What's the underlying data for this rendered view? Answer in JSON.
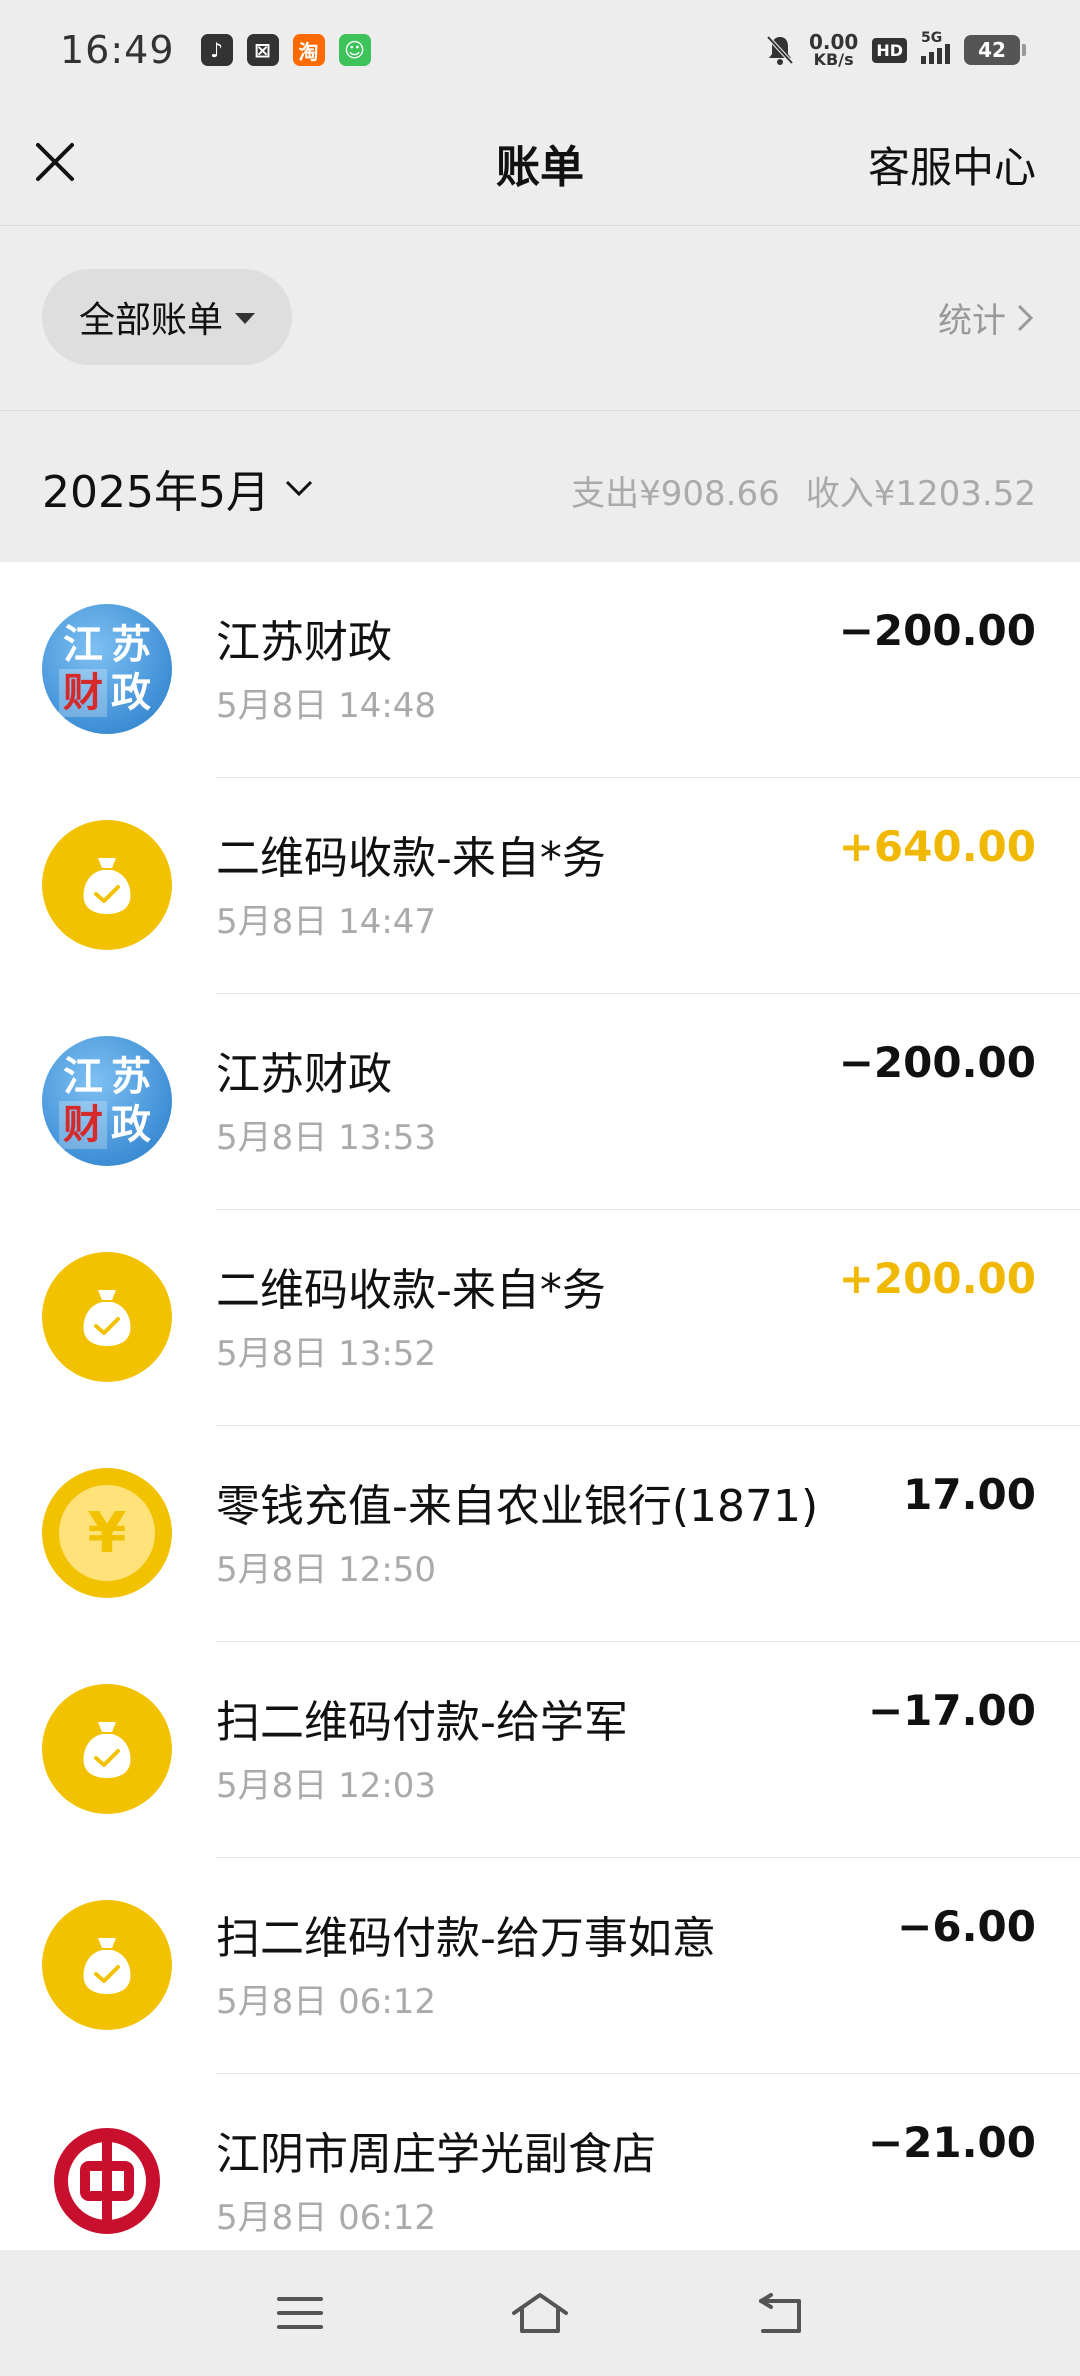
{
  "status_bar": {
    "time": "16:49",
    "net_speed_value": "0.00",
    "net_speed_unit": "KB/s",
    "hd_label": "HD",
    "network_label": "5G",
    "battery_level": "42",
    "app_icons": [
      {
        "name": "douyin-icon",
        "glyph": "♪",
        "color": "#333333"
      },
      {
        "name": "app-icon",
        "glyph": "⊠",
        "color": "#333333"
      },
      {
        "name": "taobao-icon",
        "glyph": "淘",
        "color": "#ff6a00"
      },
      {
        "name": "message-icon",
        "glyph": "☺",
        "color": "#3dc35a"
      }
    ]
  },
  "nav": {
    "title": "账单",
    "service_label": "客服中心"
  },
  "filter": {
    "all_bills_label": "全部账单",
    "stats_label": "统计"
  },
  "month": {
    "label": "2025年5月",
    "expense": "支出¥908.66",
    "income": "收入¥1203.52"
  },
  "bills": [
    {
      "avatar": "finance",
      "title": "江苏财政",
      "time": "5月8日 14:48",
      "amount": "−200.00",
      "type": "expense"
    },
    {
      "avatar": "moneybag",
      "title": "二维码收款-来自*务",
      "time": "5月8日 14:47",
      "amount": "+640.00",
      "type": "income"
    },
    {
      "avatar": "finance",
      "title": "江苏财政",
      "time": "5月8日 13:53",
      "amount": "−200.00",
      "type": "expense"
    },
    {
      "avatar": "moneybag",
      "title": "二维码收款-来自*务",
      "time": "5月8日 13:52",
      "amount": "+200.00",
      "type": "income"
    },
    {
      "avatar": "coin",
      "title": "零钱充值-来自农业银行(1871)",
      "time": "5月8日 12:50",
      "amount": "17.00",
      "type": "neutral"
    },
    {
      "avatar": "moneybag",
      "title": "扫二维码付款-给学军",
      "time": "5月8日 12:03",
      "amount": "−17.00",
      "type": "expense"
    },
    {
      "avatar": "moneybag",
      "title": "扫二维码付款-给万事如意",
      "time": "5月8日 06:12",
      "amount": "−6.00",
      "type": "expense"
    },
    {
      "avatar": "boc",
      "title": "江阴市周庄学光副食店",
      "time": "5月8日 06:12",
      "amount": "−21.00",
      "type": "expense"
    }
  ],
  "finance_avatar_chars": [
    "江",
    "苏",
    "财",
    "政"
  ],
  "coin_glyph": "¥",
  "colors": {
    "income": "#f0b800",
    "yellow_avatar": "#f2c200",
    "boc_red": "#c8102e"
  }
}
